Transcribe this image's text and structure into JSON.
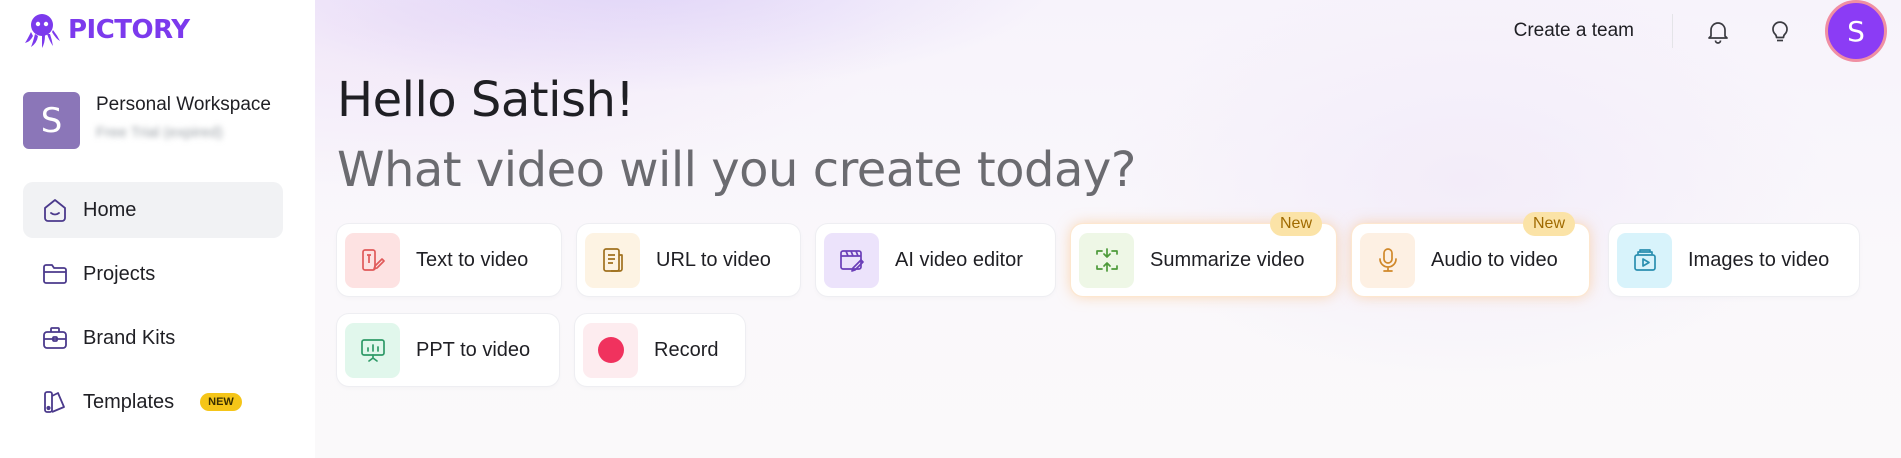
{
  "brand": {
    "name": "PICTORY",
    "color": "#7c3aed"
  },
  "workspace": {
    "avatar_letter": "S",
    "name": "Personal Workspace",
    "subtitle": "Free Trial (expired)"
  },
  "nav": {
    "items": [
      {
        "label": "Home",
        "icon": "home-icon"
      },
      {
        "label": "Projects",
        "icon": "folder-icon"
      },
      {
        "label": "Brand Kits",
        "icon": "briefcase-icon"
      },
      {
        "label": "Templates",
        "icon": "palette-icon",
        "badge": "NEW"
      }
    ]
  },
  "topbar": {
    "create_team": "Create a team",
    "avatar_letter": "S",
    "icons": [
      "bell-icon",
      "lightbulb-icon"
    ]
  },
  "main": {
    "greeting": "Hello Satish!",
    "prompt": "What video will you create today?",
    "cards": [
      {
        "label": "Text to video",
        "icon": "text-to-video-icon",
        "icon_bg": "#fde2e2"
      },
      {
        "label": "URL to video",
        "icon": "document-icon",
        "icon_bg": "#fdf3e3"
      },
      {
        "label": "AI video editor",
        "icon": "calendar-edit-icon",
        "icon_bg": "#ece3fb"
      },
      {
        "label": "Summarize video",
        "icon": "summarize-icon",
        "icon_bg": "#eef7e6",
        "badge": "New"
      },
      {
        "label": "Audio to video",
        "icon": "microphone-icon",
        "icon_bg": "#fdf0e3",
        "badge": "New"
      },
      {
        "label": "Images to video",
        "icon": "images-icon",
        "icon_bg": "#d8f3fb"
      },
      {
        "label": "PPT to video",
        "icon": "presentation-icon",
        "icon_bg": "#e1f7ec"
      },
      {
        "label": "Record",
        "icon": "record-icon",
        "icon_bg": "#fdecef"
      }
    ]
  }
}
